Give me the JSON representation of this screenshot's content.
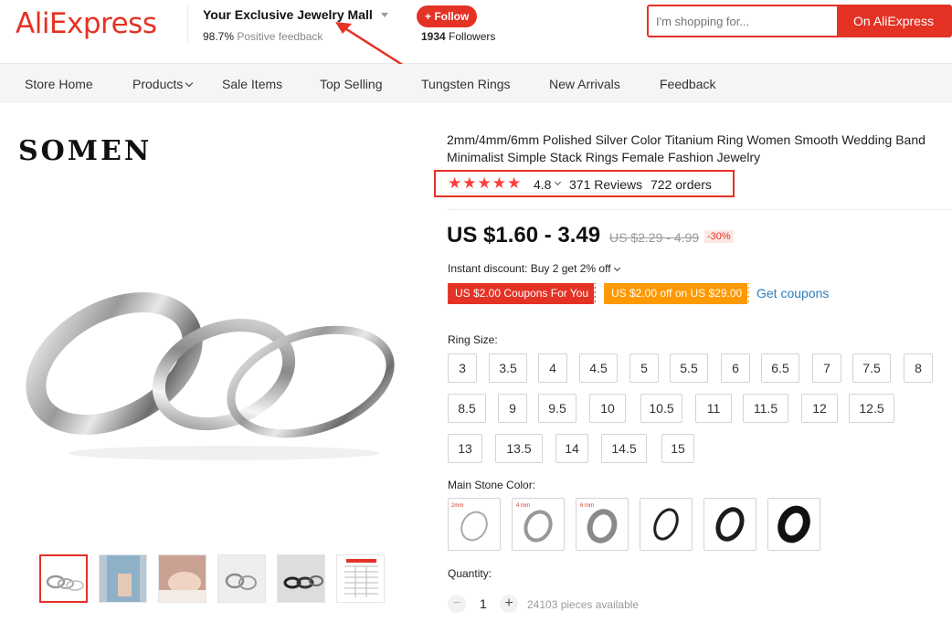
{
  "header": {
    "logo": "AliExpress",
    "store_name": "Your Exclusive Jewelry Mall",
    "feedback_pct": "98.7%",
    "feedback_label": "Positive feedback",
    "follow_label": "+ Follow",
    "followers_count": "1934",
    "followers_label": "Followers",
    "search_placeholder": "I'm shopping for...",
    "search_button": "On AliExpress"
  },
  "nav": {
    "items": [
      "Store Home",
      "Products",
      "Sale Items",
      "Top Selling",
      "Tungsten Rings",
      "New Arrivals",
      "Feedback"
    ]
  },
  "gallery": {
    "brand": "SOMEN",
    "thumbnail_count": 6
  },
  "product": {
    "title": "2mm/4mm/6mm Polished Silver Color Titanium Ring Women Smooth Wedding Band Minimalist Simple Stack Rings Female Fashion Jewelry",
    "stars": "★★★★★",
    "rating": "4.8",
    "reviews": "371 Reviews",
    "orders": "722 orders",
    "price": "US $1.60 - 3.49",
    "old_price": "US $2.29 - 4.99",
    "discount": "-30%",
    "instant_discount": "Instant discount: Buy 2 get 2% off",
    "coupon1": "US $2.00 Coupons For You",
    "coupon2": "US $2.00 off on US $29.00",
    "get_coupons": "Get coupons",
    "ring_size_label": "Ring Size:",
    "sizes": [
      "3",
      "3.5",
      "4",
      "4.5",
      "5",
      "5.5",
      "6",
      "6.5",
      "7",
      "7.5",
      "8",
      "8.5",
      "9",
      "9.5",
      "10",
      "10.5",
      "11",
      "11.5",
      "12",
      "12.5",
      "13",
      "13.5",
      "14",
      "14.5",
      "15"
    ],
    "stone_color_label": "Main Stone Color:",
    "stone_labels": [
      "2mm",
      "4 mm",
      "6 mm"
    ],
    "quantity_label": "Quantity:",
    "qty_minus": "−",
    "quantity": "1",
    "qty_plus": "+",
    "available": "24103 pieces available"
  },
  "colors": {
    "brand_red": "#e43225",
    "coupon_orange": "#ff9900",
    "link_blue": "#2b7dbc",
    "star_red": "#ff3d3d"
  }
}
